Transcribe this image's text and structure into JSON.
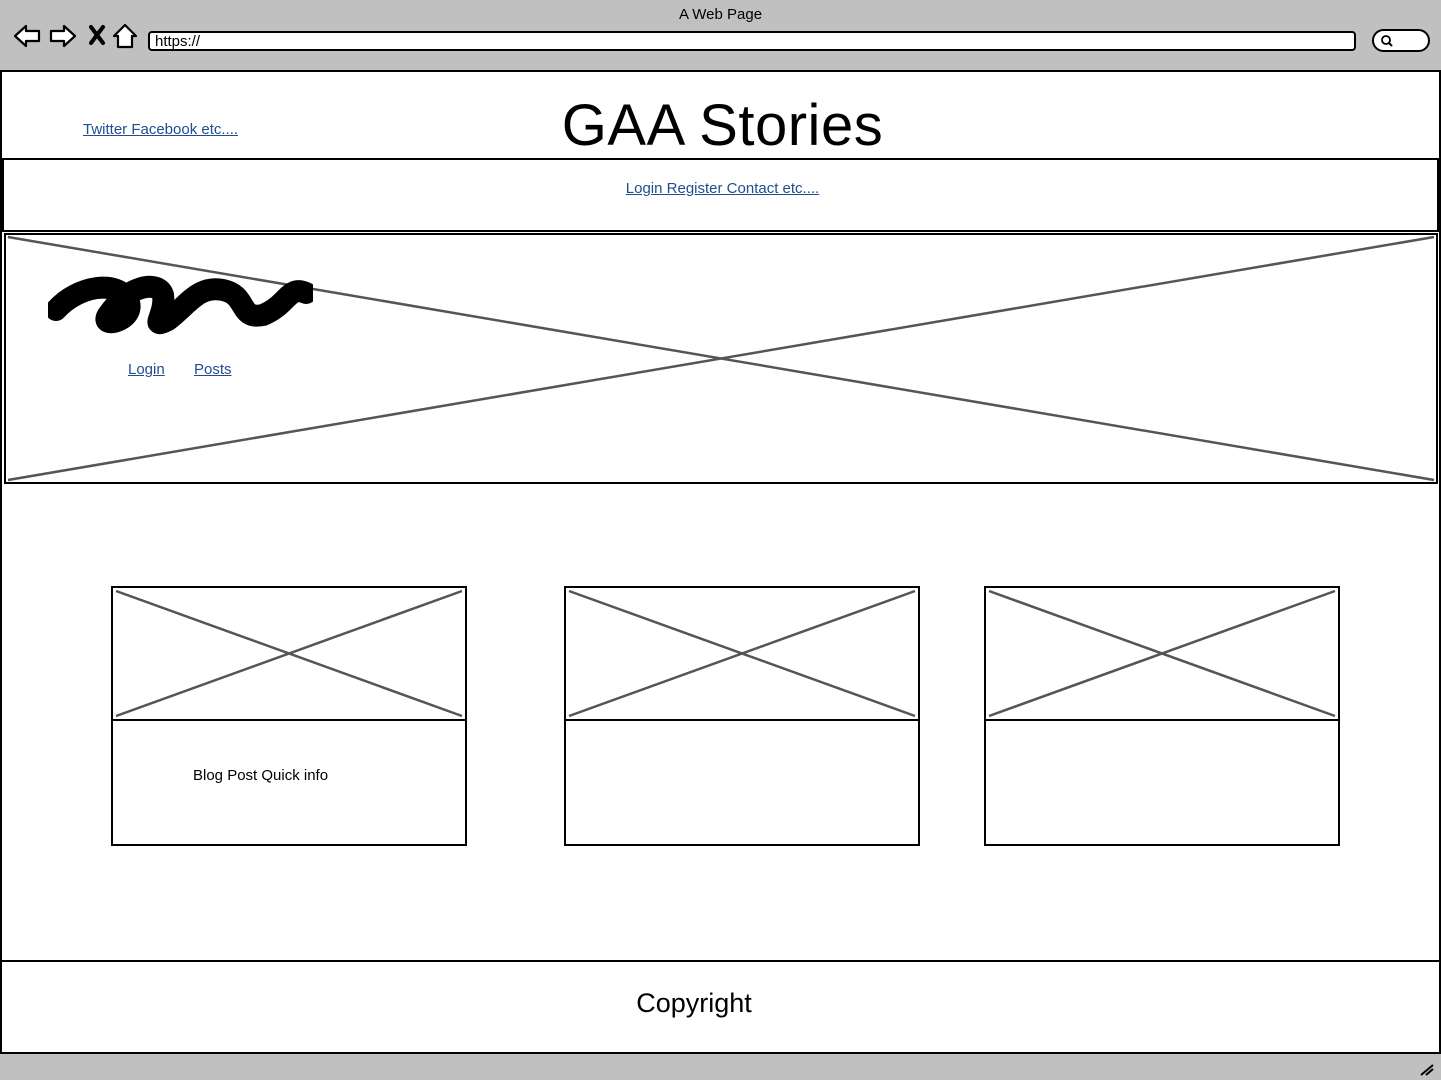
{
  "browser": {
    "title": "A Web Page",
    "url": "https://",
    "icons": [
      "back-icon",
      "forward-icon",
      "close-icon",
      "home-icon",
      "search-icon"
    ]
  },
  "header": {
    "social_link": "Twitter Facebook etc....",
    "site_title": "GAA Stories"
  },
  "navbar": {
    "link": "Login Register Contact etc...."
  },
  "hero": {
    "links": [
      "Login",
      "Posts"
    ]
  },
  "cards": [
    {
      "text": "Blog Post Quick info"
    },
    {
      "text": ""
    },
    {
      "text": ""
    }
  ],
  "footer": {
    "text": "Copyright"
  }
}
